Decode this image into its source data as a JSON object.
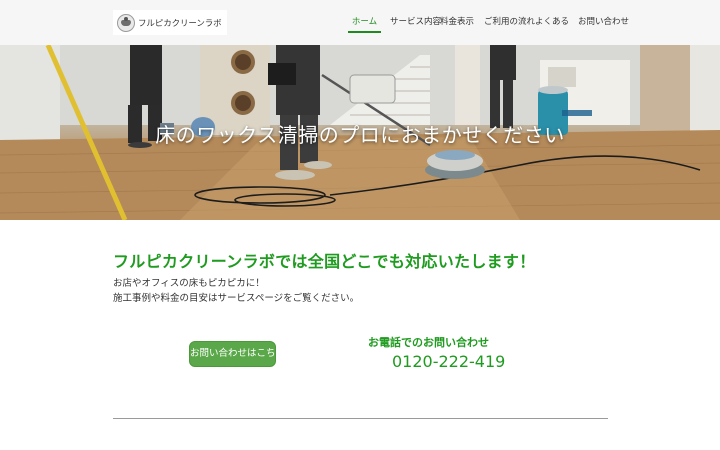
{
  "header": {
    "logo_text": "フルピカクリーンラボ",
    "nav": [
      {
        "label": "ホーム",
        "active": true
      },
      {
        "label": "サービス内容"
      },
      {
        "label": "料金表示"
      },
      {
        "label": "ご利用の流れ"
      },
      {
        "label": "よくある"
      },
      {
        "label": "お問い合わせ"
      }
    ]
  },
  "hero": {
    "title": "床のワックス清掃のプロにおまかせください"
  },
  "main": {
    "headline": "フルピカクリーンラボでは全国どこでも対応いたします！",
    "description_1": "お店やオフィスの床もピカピカに！",
    "description_2": "施工事例や料金の目安はサービスページをご覧ください。",
    "cta_label": "お問い合わせはこちら",
    "phone_label": "お電話でのお問い合わせ",
    "phone_number": "0120-222-419"
  },
  "colors": {
    "accent": "#1f9b1f",
    "button": "#5ba84a",
    "header_bg": "#f5f6f5"
  }
}
